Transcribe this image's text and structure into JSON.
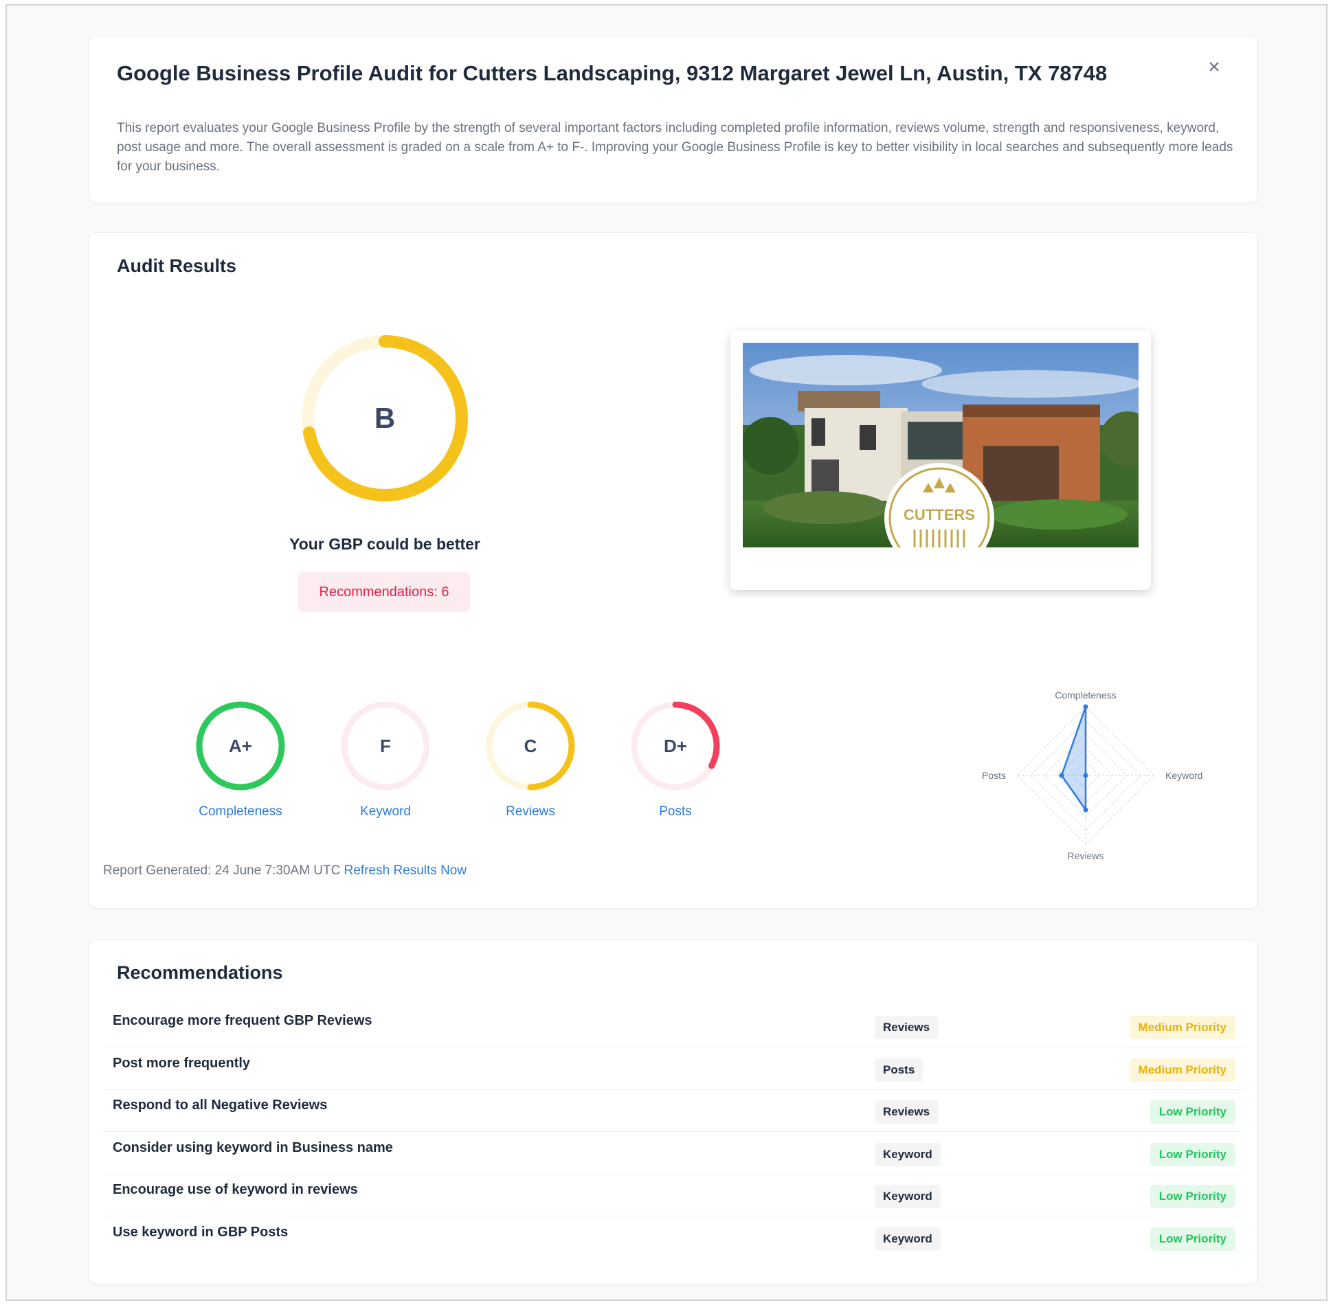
{
  "header": {
    "title": "Google Business Profile Audit for Cutters Landscaping, 9312 Margaret Jewel Ln, Austin, TX 78748",
    "close_icon": "close-icon",
    "description": "This report evaluates your Google Business Profile by the strength of several important factors including completed profile information, reviews volume, strength and responsiveness, keyword, post usage and more. The overall assessment is graded on a scale from A+ to F-. Improving your Google Business Profile is key to better visibility in local searches and subsequently more leads for your business."
  },
  "audit": {
    "title": "Audit Results",
    "overall": {
      "grade": "B",
      "progress": 0.72,
      "color": "#f5c21b",
      "track_color": "#fef6dc",
      "caption": "Your GBP could be better",
      "recommendations_label": "Recommendations: 6"
    },
    "profile_image": {
      "logo_text": "CUTTERS",
      "logo_color": "#c4a84a"
    },
    "categories": [
      {
        "grade": "A+",
        "label": "Completeness",
        "progress": 1.0,
        "color": "#2ec95c",
        "track": "#e3f8ea"
      },
      {
        "grade": "F",
        "label": "Keyword",
        "progress": 0.0,
        "color": "#f43f5e",
        "track": "#fdecef"
      },
      {
        "grade": "C",
        "label": "Reviews",
        "progress": 0.5,
        "color": "#f5c21b",
        "track": "#fef6dc"
      },
      {
        "grade": "D+",
        "label": "Posts",
        "progress": 0.33,
        "color": "#f43f5e",
        "track": "#fdecef"
      }
    ],
    "radar": {
      "axes": [
        "Completeness",
        "Keyword",
        "Reviews",
        "Posts"
      ],
      "values": [
        1.0,
        0.0,
        0.5,
        0.35
      ],
      "color": "#2b7be0"
    },
    "report_generated": "Report Generated: 24 June 7:30AM UTC",
    "refresh_label": "Refresh Results Now"
  },
  "recommendations": {
    "title": "Recommendations",
    "items": [
      {
        "text": "Encourage more frequent GBP Reviews",
        "category": "Reviews",
        "priority": "Medium Priority",
        "level": "medium"
      },
      {
        "text": "Post more frequently",
        "category": "Posts",
        "priority": "Medium Priority",
        "level": "medium"
      },
      {
        "text": "Respond to all Negative Reviews",
        "category": "Reviews",
        "priority": "Low Priority",
        "level": "low"
      },
      {
        "text": "Consider using keyword in Business name",
        "category": "Keyword",
        "priority": "Low Priority",
        "level": "low"
      },
      {
        "text": "Encourage use of keyword in reviews",
        "category": "Keyword",
        "priority": "Low Priority",
        "level": "low"
      },
      {
        "text": "Use keyword in GBP Posts",
        "category": "Keyword",
        "priority": "Low Priority",
        "level": "low"
      }
    ]
  }
}
